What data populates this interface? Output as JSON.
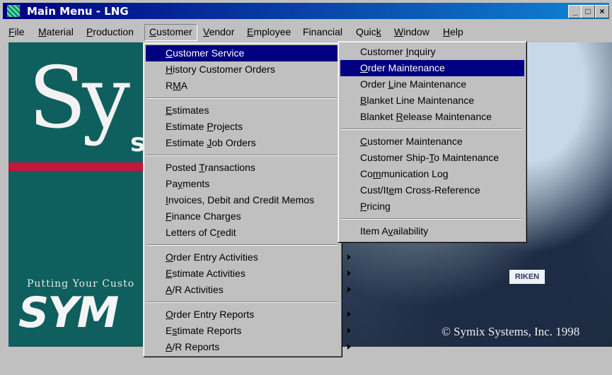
{
  "window": {
    "title": "Main Menu - LNG"
  },
  "titlebar": {
    "minimize": "_",
    "maximize": "□",
    "close": "×"
  },
  "menubar": [
    {
      "label": "File",
      "ul": "F",
      "rest": "ile"
    },
    {
      "label": "Material",
      "ul": "M",
      "rest": "aterial"
    },
    {
      "label": "Production",
      "ul": "P",
      "rest": "roduction"
    },
    {
      "label": "Customer",
      "ul": "C",
      "rest": "ustomer"
    },
    {
      "label": "Vendor",
      "ul": "V",
      "rest": "endor"
    },
    {
      "label": "Employee",
      "ul": "E",
      "rest": "mployee"
    },
    {
      "label": "Financial",
      "ul": "",
      "rest": "Financial"
    },
    {
      "label": "Quick",
      "pre": "Quic",
      "ul": "k",
      "rest": ""
    },
    {
      "label": "Window",
      "ul": "W",
      "rest": "indow"
    },
    {
      "label": "Help",
      "ul": "H",
      "rest": "elp"
    }
  ],
  "customer_menu": {
    "items": [
      {
        "pre": "",
        "ul": "C",
        "rest": "ustomer Service",
        "submenu": true
      },
      {
        "pre": "",
        "ul": "H",
        "rest": "istory Customer Orders"
      },
      {
        "pre": "R",
        "ul": "M",
        "rest": "A"
      },
      {
        "pre": "",
        "ul": "E",
        "rest": "stimates"
      },
      {
        "pre": "Estimate ",
        "ul": "P",
        "rest": "rojects"
      },
      {
        "pre": "Estimate ",
        "ul": "J",
        "rest": "ob Orders"
      },
      {
        "pre": "Posted ",
        "ul": "T",
        "rest": "ransactions"
      },
      {
        "pre": "Pa",
        "ul": "y",
        "rest": "ments"
      },
      {
        "pre": "",
        "ul": "I",
        "rest": "nvoices, Debit and Credit Memos"
      },
      {
        "pre": "",
        "ul": "F",
        "rest": "inance Charges"
      },
      {
        "pre": "Letters of C",
        "ul": "r",
        "rest": "edit"
      },
      {
        "pre": "",
        "ul": "O",
        "rest": "rder Entry Activities",
        "submenu": true
      },
      {
        "pre": "",
        "ul": "E",
        "rest": "stimate Activities",
        "submenu": true
      },
      {
        "pre": "",
        "ul": "A",
        "rest": "/R Activities",
        "submenu": true
      },
      {
        "pre": "",
        "ul": "O",
        "rest": "rder Entry Reports",
        "submenu": true
      },
      {
        "pre": "E",
        "ul": "s",
        "rest": "timate Reports",
        "submenu": true
      },
      {
        "pre": "",
        "ul": "A",
        "rest": "/R Reports",
        "submenu": true
      }
    ]
  },
  "service_submenu": {
    "items": [
      {
        "pre": "Customer ",
        "ul": "I",
        "rest": "nquiry"
      },
      {
        "pre": "",
        "ul": "O",
        "rest": "rder Maintenance"
      },
      {
        "pre": "Order ",
        "ul": "L",
        "rest": "ine Maintenance"
      },
      {
        "pre": "",
        "ul": "B",
        "rest": "lanket Line Maintenance"
      },
      {
        "pre": "Blanket ",
        "ul": "R",
        "rest": "elease Maintenance"
      },
      {
        "pre": "",
        "ul": "C",
        "rest": "ustomer Maintenance"
      },
      {
        "pre": "Customer Ship-",
        "ul": "T",
        "rest": "o Maintenance"
      },
      {
        "pre": "Co",
        "ul": "m",
        "rest": "munication Log"
      },
      {
        "pre": "Cust/It",
        "ul": "e",
        "rest": "m Cross-Reference"
      },
      {
        "pre": "",
        "ul": "P",
        "rest": "ricing"
      },
      {
        "pre": "Item A",
        "ul": "v",
        "rest": "ailability"
      }
    ]
  },
  "splash": {
    "brand_big": "Sy",
    "brand_small": "s",
    "tagline": "Putting Your Custo",
    "brand_logo": "SYM",
    "copyright": "© Symix Systems, Inc. 1998",
    "sticker": "RIKEN"
  }
}
